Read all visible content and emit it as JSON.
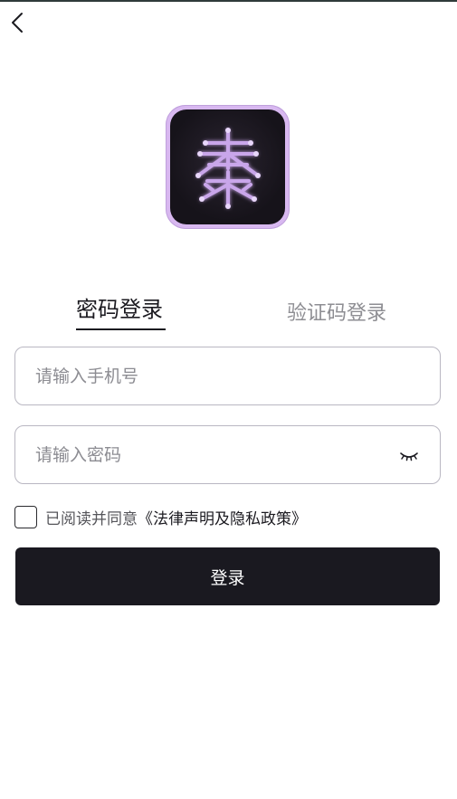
{
  "header": {
    "back_icon": "chevron-left-icon"
  },
  "logo": {
    "glyph": "秦",
    "icon": "app-logo-icon",
    "accent": "#d8b8f0"
  },
  "tabs": [
    {
      "label": "密码登录",
      "active": true
    },
    {
      "label": "验证码登录",
      "active": false
    }
  ],
  "form": {
    "phone": {
      "placeholder": "请输入手机号",
      "value": ""
    },
    "password": {
      "placeholder": "请输入密码",
      "value": "",
      "toggle_icon": "eye-closed-icon"
    }
  },
  "agreement": {
    "checked": false,
    "text": "已阅读并同意",
    "link": "《法律声明及隐私政策》"
  },
  "login_button": {
    "label": "登录",
    "color": "#1a1920"
  }
}
